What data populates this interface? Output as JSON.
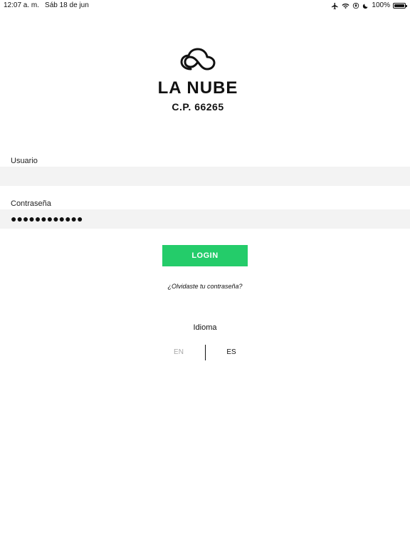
{
  "status_bar": {
    "time": "12:07 a. m.",
    "date": "Sáb 18 de jun",
    "battery": "100%",
    "icons": [
      "airplane-icon",
      "wifi-icon",
      "orientation-lock-icon",
      "moon-icon",
      "battery-icon"
    ]
  },
  "brand": {
    "logo_icon": "cloud-icon",
    "name": "LA NUBE",
    "subtitle": "C.P. 66265"
  },
  "form": {
    "username_label": "Usuario",
    "username_value": "",
    "password_label": "Contraseña",
    "password_masked": "●●●●●●●●●●●●",
    "login_label": "LOGIN",
    "forgot_password": "¿Olvidaste tu contraseña?"
  },
  "language": {
    "label": "Idioma",
    "options": [
      "EN",
      "ES"
    ],
    "selected": "ES"
  },
  "colors": {
    "accent": "#24cc6a",
    "input_bg": "#f3f3f3",
    "inactive_text": "#a9a9a9"
  }
}
